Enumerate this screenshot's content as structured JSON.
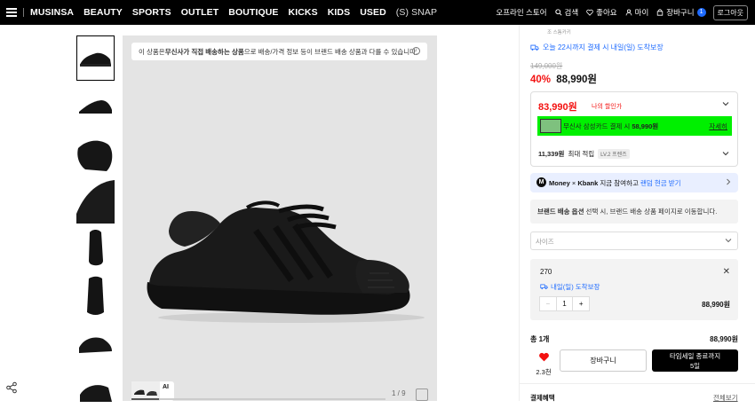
{
  "nav": {
    "links": [
      "MUSINSA",
      "BEAUTY",
      "SPORTS",
      "OUTLET",
      "BOUTIQUE",
      "KICKS",
      "KIDS",
      "USED"
    ],
    "snap": "(S) SNAP",
    "offline_store": "오프라인 스토어",
    "search": "검색",
    "likes": "좋아요",
    "my": "마이",
    "cart": "장바구니",
    "cart_count": "1",
    "logout": "로그아웃"
  },
  "gallery": {
    "notice_pre": "이 상품은 ",
    "notice_bold": "무신사가 직접 배송하는 상품",
    "notice_post": "으로 배송/가격 정보 등이 브랜드 배송 상품과 다를 수 있습니다.",
    "ai_label": "AI",
    "counter": "1 / 9",
    "progress": 0.11
  },
  "product": {
    "tag": "조 스톰카키",
    "delivery": "오늘 22시까지 결제 시 내일(일) 도착보장",
    "original_price": "149,000원",
    "discount": "40%",
    "price": "88,990원",
    "my_price": "83,990원",
    "my_price_label": "나의 할인가",
    "card_text_pre": "무신사 삼성카드 결제 시 ",
    "card_text_bold": "58,990원",
    "card_detail": "자세히",
    "points_bold": "11,339원",
    "points_label": "최대 적립",
    "level": "LV.2 프렌즈",
    "kbank_brand": "Money",
    "kbank_x": "×",
    "kbank_name": "Kbank",
    "kbank_text": "지금 참여하고",
    "kbank_link": "랜덤 현금 받기",
    "brand_ship_bold": "브랜드 배송 옵션",
    "brand_ship_text": " 선택 시, 브랜드 배송 상품 페이지로 이동합니다.",
    "size_placeholder": "사이즈",
    "selected_size": "270",
    "selected_delivery": "내일(일) 도착보장",
    "quantity": "1",
    "option_price": "88,990원",
    "total_label": "총 1개",
    "total_price": "88,990원",
    "likes": "2.3천",
    "cart_button": "장바구니",
    "buy_line1": "타임세일 종료까지",
    "buy_line2": "5일",
    "benefit_label": "결제혜택",
    "benefit_all": "전체보기"
  },
  "colors": {
    "accent_blue": "#1e6bff",
    "sale_red": "#f31110",
    "card_green": "#00f000"
  }
}
